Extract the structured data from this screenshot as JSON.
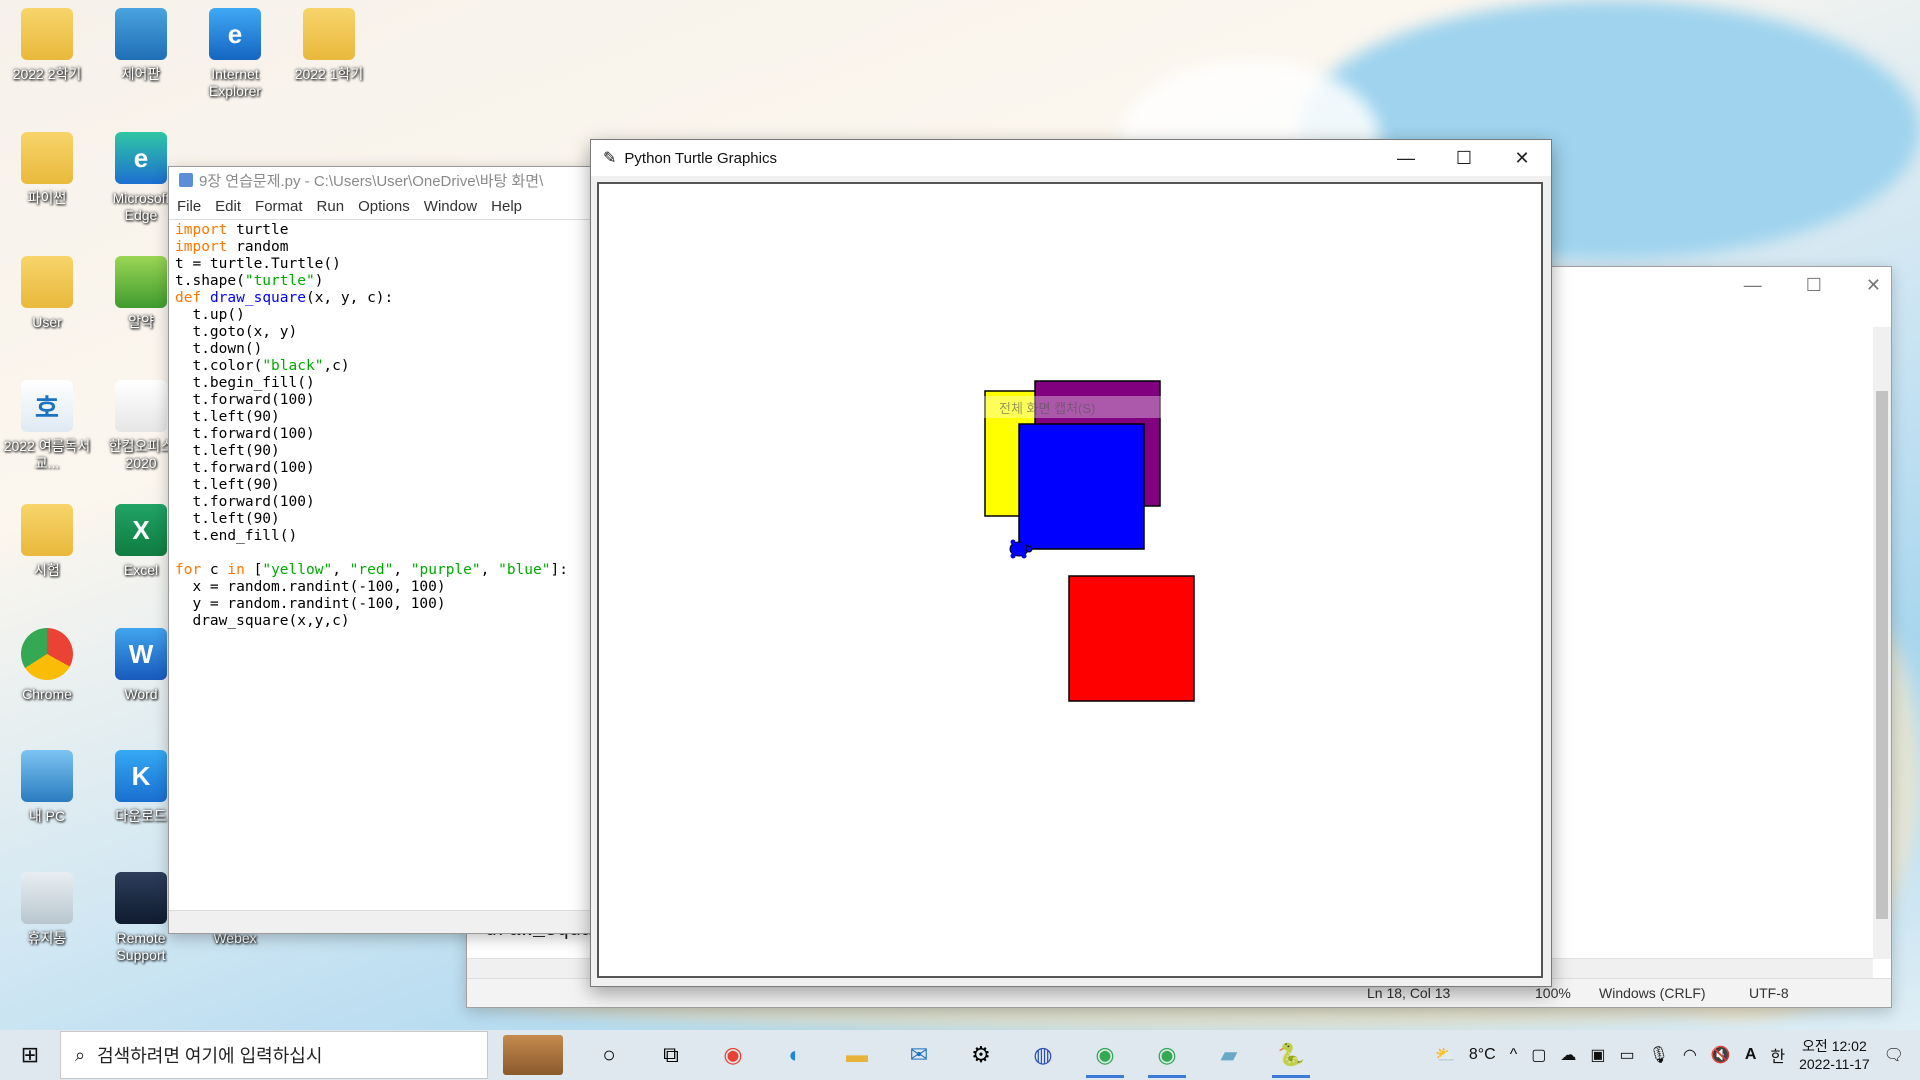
{
  "desktop_icons": [
    {
      "label": "2022 2학기",
      "icon": "folder-icon"
    },
    {
      "label": "제어판",
      "icon": "control-panel-icon"
    },
    {
      "label": "Internet Explorer",
      "icon": "internet-explorer-icon"
    },
    {
      "label": "2022 1학기",
      "icon": "folder-icon"
    },
    {
      "label": "파이썬",
      "icon": "folder-icon"
    },
    {
      "label": "Microsoft Edge",
      "icon": "edge-icon"
    },
    {
      "label": "User",
      "icon": "user-folder-icon"
    },
    {
      "label": "알약",
      "icon": "alyac-icon"
    },
    {
      "label": "2022 여름독서교...",
      "icon": "hancom-icon"
    },
    {
      "label": "한컴오피스 2020",
      "icon": "hancom-office-icon"
    },
    {
      "label": "시험",
      "icon": "folder-icon"
    },
    {
      "label": "Excel",
      "icon": "excel-icon"
    },
    {
      "label": "Chrome",
      "icon": "chrome-icon"
    },
    {
      "label": "Word",
      "icon": "word-icon"
    },
    {
      "label": "내 PC",
      "icon": "pc-icon"
    },
    {
      "label": "다운로드",
      "icon": "download-icon"
    },
    {
      "label": "휴지통",
      "icon": "recycle-bin-icon"
    },
    {
      "label": "Remote Support",
      "icon": "remote-support-icon"
    },
    {
      "label": "Webex",
      "icon": "webex-icon"
    }
  ],
  "idle": {
    "title": "9장 연습문제.py - C:\\Users\\User\\OneDrive\\바탕 화면\\",
    "menu": [
      "File",
      "Edit",
      "Format",
      "Run",
      "Options",
      "Window",
      "Help"
    ],
    "code_lines": [
      [
        [
          "kw",
          "import"
        ],
        [
          "t",
          " turtle"
        ]
      ],
      [
        [
          "kw",
          "import"
        ],
        [
          "t",
          " random"
        ]
      ],
      [
        [
          "t",
          "t = turtle.Turtle()"
        ]
      ],
      [
        [
          "t",
          "t.shape("
        ],
        [
          "str",
          "\"turtle\""
        ],
        [
          "t",
          ")"
        ]
      ],
      [
        [
          "kw",
          "def"
        ],
        [
          "t",
          " "
        ],
        [
          "fn",
          "draw_square"
        ],
        [
          "t",
          "(x, y, c):"
        ]
      ],
      [
        [
          "t",
          "  t.up()"
        ]
      ],
      [
        [
          "t",
          "  t.goto(x, y)"
        ]
      ],
      [
        [
          "t",
          "  t.down()"
        ]
      ],
      [
        [
          "t",
          "  t.color("
        ],
        [
          "str",
          "\"black\""
        ],
        [
          "t",
          ",c)"
        ]
      ],
      [
        [
          "t",
          "  t.begin_fill()"
        ]
      ],
      [
        [
          "t",
          "  t.forward(100)"
        ]
      ],
      [
        [
          "t",
          "  t.left(90)"
        ]
      ],
      [
        [
          "t",
          "  t.forward(100)"
        ]
      ],
      [
        [
          "t",
          "  t.left(90)"
        ]
      ],
      [
        [
          "t",
          "  t.forward(100)"
        ]
      ],
      [
        [
          "t",
          "  t.left(90)"
        ]
      ],
      [
        [
          "t",
          "  t.forward(100)"
        ]
      ],
      [
        [
          "t",
          "  t.left(90)"
        ]
      ],
      [
        [
          "t",
          "  t.end_fill()"
        ]
      ],
      [
        [
          "t",
          ""
        ]
      ],
      [
        [
          "kw",
          "for"
        ],
        [
          "t",
          " c "
        ],
        [
          "kw",
          "in"
        ],
        [
          "t",
          " ["
        ],
        [
          "str",
          "\"yellow\""
        ],
        [
          "t",
          ", "
        ],
        [
          "str",
          "\"red\""
        ],
        [
          "t",
          ", "
        ],
        [
          "str",
          "\"purple\""
        ],
        [
          "t",
          ", "
        ],
        [
          "str",
          "\"blue\""
        ],
        [
          "t",
          "]:"
        ]
      ],
      [
        [
          "t",
          "  x = random.randint(-100, 100)"
        ]
      ],
      [
        [
          "t",
          "  y = random.randint(-100, 100)"
        ]
      ],
      [
        [
          "t",
          "  draw_square(x,y,c)"
        ]
      ]
    ]
  },
  "background_window": {
    "snippet": "draw_squar",
    "status": {
      "position": "Ln 18, Col 13",
      "zoom": "100%",
      "line_ending": "Windows (CRLF)",
      "encoding": "UTF-8"
    }
  },
  "turtle_window": {
    "title": "Python Turtle Graphics",
    "overlay_text": "전체 화면 캡처(S)",
    "square_colors": {
      "yellow": "#ffff00",
      "purple": "#800080",
      "blue": "#0000ff",
      "red": "#ff0000"
    }
  },
  "taskbar": {
    "search_placeholder": "검색하려면 여기에 입력하십시",
    "weather": "8°C",
    "ime": "한",
    "font_indicator": "A",
    "time": "오전 12:02",
    "date": "2022-11-17"
  }
}
